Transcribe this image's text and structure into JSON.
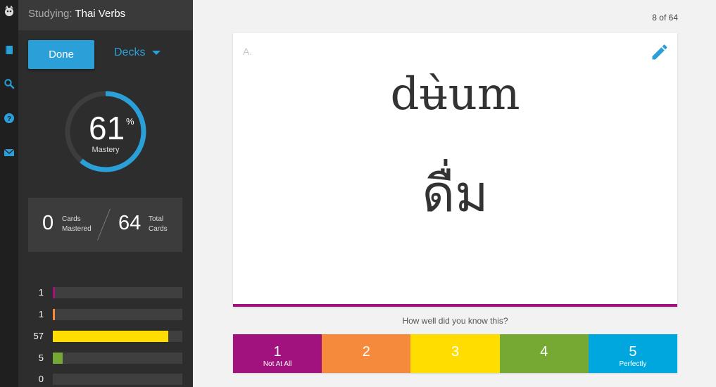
{
  "rail": {
    "icons": [
      "logo-icon",
      "book-icon",
      "search-icon",
      "help-icon",
      "mail-icon"
    ]
  },
  "header": {
    "studying_label": "Studying:",
    "deck_name": "Thai Verbs"
  },
  "sidebar": {
    "done_label": "Done",
    "decks_label": "Decks",
    "mastery": {
      "percent": 61,
      "value": "61",
      "sign": "%",
      "label": "Mastery"
    },
    "stats": {
      "mastered_count": "0",
      "mastered_label_1": "Cards",
      "mastered_label_2": "Mastered",
      "total_count": "64",
      "total_label_1": "Total",
      "total_label_2": "Cards"
    },
    "confidence_bars": [
      {
        "count": "1",
        "fraction": 0.017,
        "color": "#a1127f"
      },
      {
        "count": "1",
        "fraction": 0.017,
        "color": "#f58a3d"
      },
      {
        "count": "57",
        "fraction": 0.89,
        "color": "#ffdd00"
      },
      {
        "count": "5",
        "fraction": 0.078,
        "color": "#76a933"
      },
      {
        "count": "0",
        "fraction": 0,
        "color": "#2a9fd8"
      }
    ]
  },
  "main": {
    "counter": "8 of 64",
    "card": {
      "side_label": "A.",
      "line1": "dʉ̀um",
      "line2": "ดื่ม",
      "accent_color": "#a1127f"
    },
    "question": "How well did you know this?",
    "ratings": [
      {
        "number": "1",
        "label": "Not At All",
        "color": "#a1127f"
      },
      {
        "number": "2",
        "label": "",
        "color": "#f58a3d"
      },
      {
        "number": "3",
        "label": "",
        "color": "#ffdd00"
      },
      {
        "number": "4",
        "label": "",
        "color": "#76a933"
      },
      {
        "number": "5",
        "label": "Perfectly",
        "color": "#00a6de"
      }
    ]
  },
  "colors": {
    "accent": "#2a9fd8",
    "sidebar_bg": "#2d2d2d",
    "rail_bg": "#1f1f1f"
  }
}
